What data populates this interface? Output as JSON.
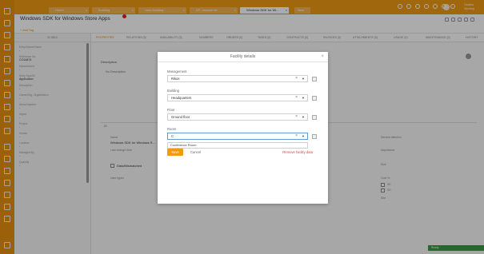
{
  "top_tabs": [
    {
      "label": "Home"
    },
    {
      "label": "Building"
    },
    {
      "label": "New Building"
    },
    {
      "label": "AP: readme.txt"
    },
    {
      "label": "Windows SDK for Wi..."
    },
    {
      "label": "New"
    }
  ],
  "user": {
    "name": "Daniela",
    "role": "Working"
  },
  "title_bar": {
    "title": "Windows SDK for Windows Store Apps",
    "new_tag": "+ Add Tag"
  },
  "left_panel": {
    "header": "ID 5813",
    "fields": [
      {
        "label": "Entry/Owner/Name",
        "value": "-"
      },
      {
        "label": "Reference No.",
        "value": "CO14874"
      },
      {
        "label": "Manufacturer",
        "value": "-"
      },
      {
        "label": "Entry Type/ID",
        "value": "Application"
      },
      {
        "label": "Description",
        "value": "-"
      },
      {
        "label": "Owner/Org. Organization",
        "value": "-"
      },
      {
        "label": "Serial Number",
        "value": "-"
      },
      {
        "label": "Import",
        "value": "-"
      },
      {
        "label": "Project",
        "value": "-"
      },
      {
        "label": "Vendor",
        "value": "-"
      },
      {
        "label": "Location",
        "value": "-"
      },
      {
        "label": "Managed By",
        "value": "-"
      },
      {
        "label": "Quantity",
        "value": "-"
      }
    ]
  },
  "main_tabs": [
    {
      "label": "PROPERTIES",
      "active": true
    },
    {
      "label": "RELATIONS (0)"
    },
    {
      "label": "AVAILABILITY (3)"
    },
    {
      "label": "NUMBERS"
    },
    {
      "label": "ORDERS (0)"
    },
    {
      "label": "TASKS (0)"
    },
    {
      "label": "CONTRACTS (0)"
    },
    {
      "label": "INVOICES (0)"
    },
    {
      "label": "ATTACHMENTS (0)"
    },
    {
      "label": "USAGE (0)"
    },
    {
      "label": "MAINTENANCE (0)"
    },
    {
      "label": "HISTORY"
    }
  ],
  "content": {
    "description_label": "Description",
    "description_value": "No Description",
    "section_toggle": "CI",
    "name_label": "Name",
    "name_value": "Windows SDK for Windows S...",
    "last_change_label": "Last change time",
    "checkbox_label": "Data/Mismatched",
    "user_types_label": "User types",
    "right_labels": [
      "Service affection",
      "Importance",
      "Size",
      "Cost %",
      "",
      "Site"
    ],
    "right_opts": [
      "SE",
      "SE"
    ]
  },
  "status": {
    "label": "Ready"
  },
  "modal": {
    "title": "Facility details",
    "management_label": "Management",
    "management_value": "Rikos",
    "building_label": "Building",
    "building_value": "Headquarters",
    "floor_label": "Floor",
    "floor_value": "Ground floor",
    "room_label": "Room",
    "room_value": "C",
    "room_suggestion": "Conference Room",
    "save_label": "Save",
    "cancel_label": "Cancel",
    "remove_label": "Remove facility data"
  },
  "colors": {
    "accent": "#ef9a12",
    "rail": "#e8900f",
    "danger": "#d64242",
    "status": "#2f9e44"
  }
}
